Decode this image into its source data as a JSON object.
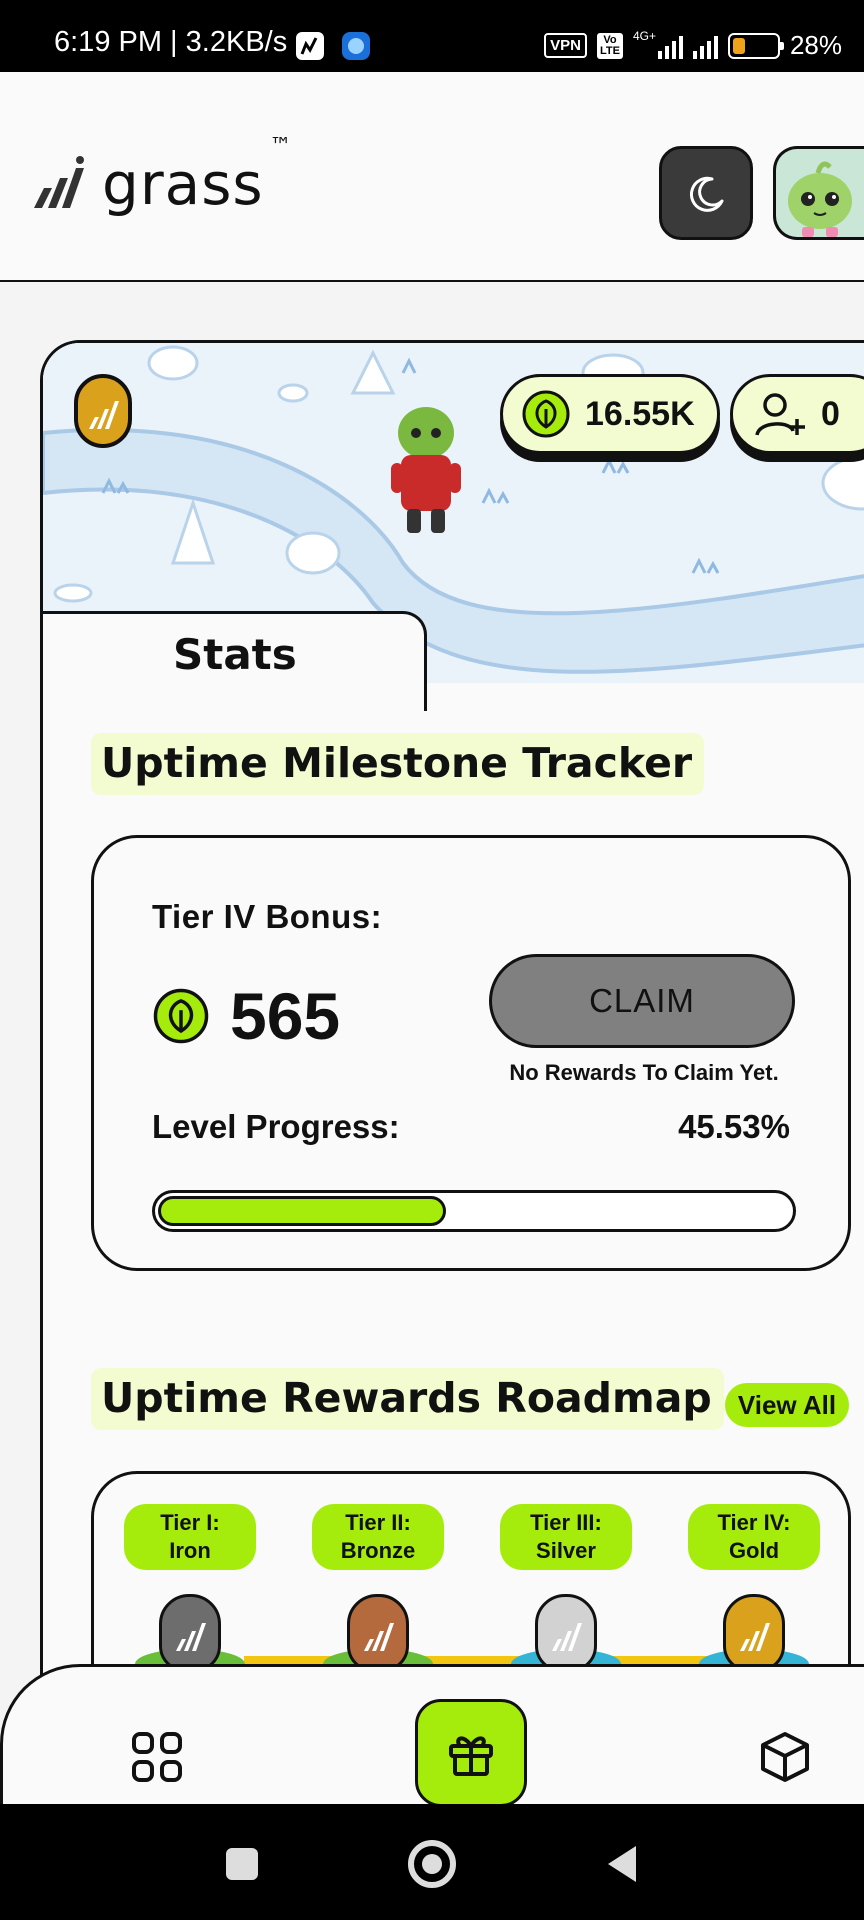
{
  "status_bar": {
    "time": "6:19 PM",
    "speed": "3.2KB/s",
    "vpn": "VPN",
    "volte_top": "Vo",
    "volte_bottom": "LTE",
    "network": "4G+",
    "battery_pct": "28%",
    "battery_level": 0.28,
    "battery_color": "#f0a21b"
  },
  "header": {
    "logo_text": "grass",
    "logo_tm": "™",
    "theme_icon": "moon-icon",
    "avatar_icon": "green-creature-avatar"
  },
  "hero": {
    "balance": "16.55K",
    "referrals": "0",
    "balance_icon": "leaf-icon",
    "referral_icon": "add-user-icon"
  },
  "tabs": {
    "active": "Stats"
  },
  "milestone": {
    "title": "Uptime Milestone Tracker",
    "tier_bonus_label": "Tier IV Bonus:",
    "bonus_value": "565",
    "claim_label": "CLAIM",
    "claim_status": "No Rewards To Claim Yet.",
    "level_progress_label": "Level Progress:",
    "level_progress_value": "45.53%",
    "level_progress_fraction": 0.4553
  },
  "roadmap": {
    "title": "Uptime Rewards Roadmap",
    "view_all": "View All",
    "tiers": [
      {
        "line1": "Tier I:",
        "line2": "Iron",
        "medal_color": "#6d6d6d",
        "ground_color": "#6abf3a"
      },
      {
        "line1": "Tier II:",
        "line2": "Bronze",
        "medal_color": "#b56a3d",
        "ground_color": "#6abf3a"
      },
      {
        "line1": "Tier III:",
        "line2": "Silver",
        "medal_color": "#d2d2d2",
        "ground_color": "#35b5d6"
      },
      {
        "line1": "Tier IV:",
        "line2": "Gold",
        "medal_color": "#d9a11c",
        "ground_color": "#35b5d6"
      }
    ]
  },
  "bottom_nav": {
    "items": [
      "grid-icon",
      "gift-icon",
      "cube-icon"
    ],
    "active": "gift-icon"
  },
  "colors": {
    "accent": "#a5ec0c",
    "pill_bg": "#f3fbd0",
    "claim_disabled": "#808080"
  }
}
